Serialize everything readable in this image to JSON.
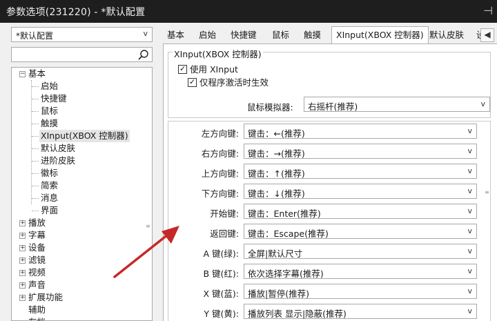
{
  "window": {
    "title": "参数选项(231220) - *默认配置",
    "pin_icon": "pin-icon"
  },
  "sidebar": {
    "preset_value": "*默认配置",
    "search_placeholder": "",
    "tree": {
      "basic": {
        "label": "基本",
        "children": [
          "启始",
          "快捷键",
          "鼠标",
          "触摸",
          "XInput(XBOX 控制器)",
          "默认皮肤",
          "进阶皮肤",
          "徽标",
          "简索",
          "消息",
          "界面"
        ],
        "selected": "XInput(XBOX 控制器)"
      },
      "groups": [
        "播放",
        "字幕",
        "设备",
        "滤镜",
        "视频",
        "声音",
        "扩展功能"
      ],
      "leaves": [
        "辅助",
        "存档"
      ]
    }
  },
  "tabs": {
    "items": [
      "基本",
      "启始",
      "快捷键",
      "鼠标",
      "触摸",
      "XInput(XBOX 控制器)",
      "默认皮肤",
      "设"
    ],
    "active": "XInput(XBOX 控制器)"
  },
  "xinput": {
    "group_title": "XInput(XBOX 控制器)",
    "use_xinput": {
      "label": "使用 XInput",
      "checked": true
    },
    "only_active": {
      "label": "仅程序激活时生效",
      "checked": true
    },
    "mouse_emulator": {
      "label": "鼠标模拟器:",
      "value": "右摇杆(推荐)"
    },
    "mappings": [
      {
        "label": "左方向键:",
        "value": "键击：←(推荐)"
      },
      {
        "label": "右方向键:",
        "value": "键击：→(推荐)"
      },
      {
        "label": "上方向键:",
        "value": "键击：↑(推荐)"
      },
      {
        "label": "下方向键:",
        "value": "键击：↓(推荐)"
      },
      {
        "label": "开始键:",
        "value": "键击：Enter(推荐)"
      },
      {
        "label": "返回键:",
        "value": "键击：Escape(推荐)"
      },
      {
        "label": "A 键(绿):",
        "value": "全屏|默认尺寸"
      },
      {
        "label": "B 键(红):",
        "value": "依次选择字幕(推荐)"
      },
      {
        "label": "X 键(蓝):",
        "value": "播放|暂停(推荐)"
      },
      {
        "label": "Y 键(黄):",
        "value": "播放列表 显示|隐蔽(推荐)"
      }
    ]
  },
  "colors": {
    "titlebar": "#1e1e1e",
    "annotation_arrow": "#c62828"
  }
}
